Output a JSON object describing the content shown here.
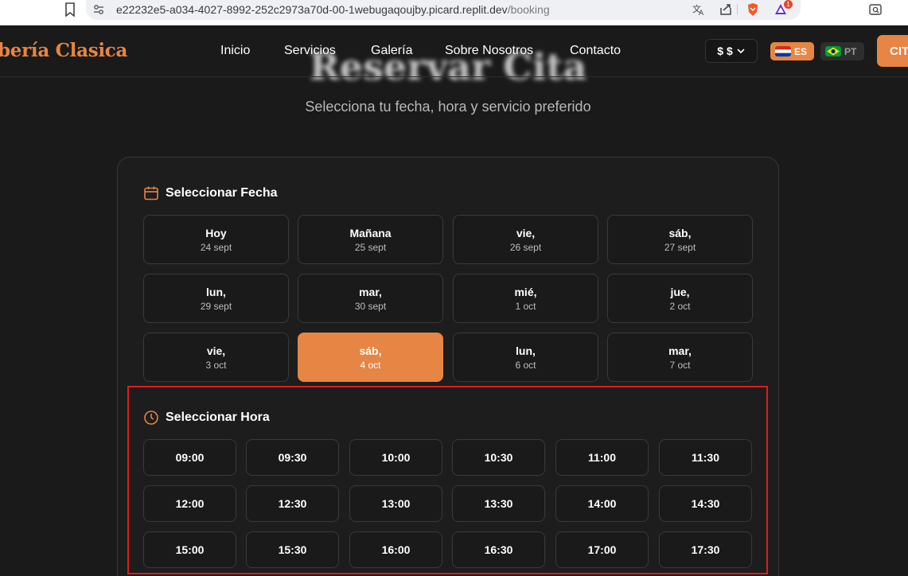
{
  "browser": {
    "url_host": "e22232e5-a034-4027-8992-252c2973a70d-00-1webugaqoujby.picard.replit.dev",
    "url_path": "/booking",
    "extension_badge": "1"
  },
  "header": {
    "brand": "bería Clasica",
    "nav": [
      "Inicio",
      "Servicios",
      "Galería",
      "Sobre Nosotros",
      "Contacto"
    ],
    "currency_symbol": "$",
    "currency_label": "$",
    "lang_es": "ES",
    "lang_pt": "PT",
    "cta_label": "CIT"
  },
  "hero": {
    "title": "Reservar Cita",
    "subtitle": "Selecciona tu fecha, hora y servicio preferido"
  },
  "date_section": {
    "title": "Seleccionar Fecha",
    "dates": [
      {
        "day": "Hoy",
        "date": "24 sept"
      },
      {
        "day": "Mañana",
        "date": "25 sept"
      },
      {
        "day": "vie,",
        "date": "26 sept"
      },
      {
        "day": "sáb,",
        "date": "27 sept"
      },
      {
        "day": "lun,",
        "date": "29 sept"
      },
      {
        "day": "mar,",
        "date": "30 sept"
      },
      {
        "day": "mié,",
        "date": "1 oct"
      },
      {
        "day": "jue,",
        "date": "2 oct"
      },
      {
        "day": "vie,",
        "date": "3 oct"
      },
      {
        "day": "sáb,",
        "date": "4 oct"
      },
      {
        "day": "lun,",
        "date": "6 oct"
      },
      {
        "day": "mar,",
        "date": "7 oct"
      }
    ],
    "selected_index": 9
  },
  "time_section": {
    "title": "Seleccionar Hora",
    "times": [
      "09:00",
      "09:30",
      "10:00",
      "10:30",
      "11:00",
      "11:30",
      "12:00",
      "12:30",
      "13:00",
      "13:30",
      "14:00",
      "14:30",
      "15:00",
      "15:30",
      "16:00",
      "16:30",
      "17:00",
      "17:30"
    ]
  },
  "colors": {
    "accent": "#e68544",
    "background": "#1a1a1a",
    "highlight": "#e01b1b"
  }
}
